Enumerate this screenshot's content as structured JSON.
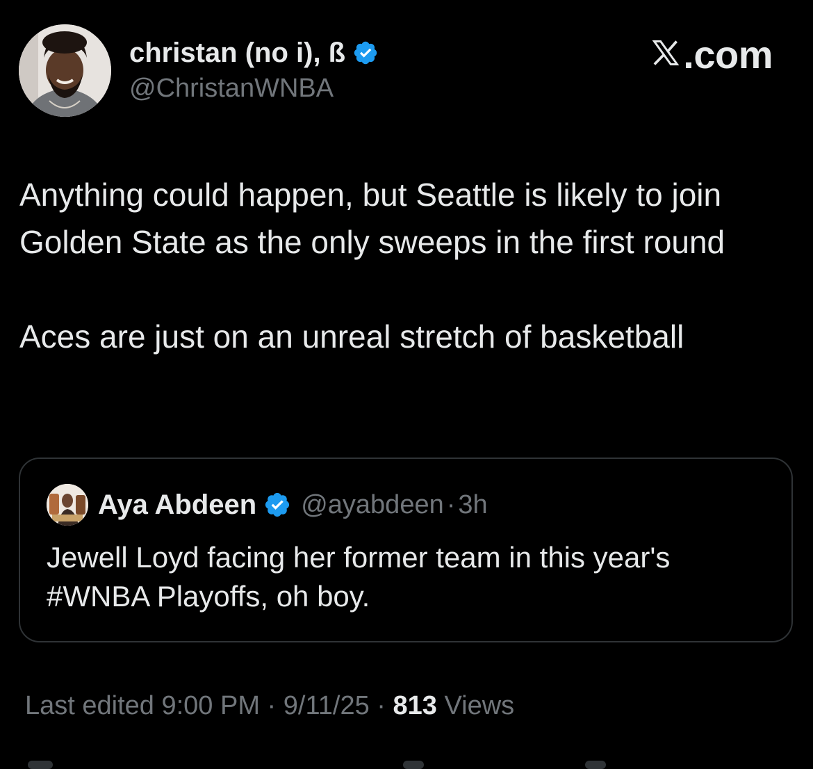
{
  "author": {
    "display_name": "christan (no i), ß",
    "handle": "@ChristanWNBA",
    "verified_icon": "verified-badge-icon"
  },
  "brand": {
    "site": ".com",
    "logo_icon": "x-logo-icon"
  },
  "tweet": {
    "paragraph_1": "Anything could happen, but Seattle is likely to join Golden State as the only sweeps in the first round",
    "paragraph_2": "Aces are just on an unreal stretch of basketball"
  },
  "quoted_tweet": {
    "display_name": "Aya Abdeen",
    "handle": "@ayabdeen",
    "separator": "·",
    "time": "3h",
    "text": "Jewell Loyd facing her former team in this year's #WNBA Playoffs, oh boy."
  },
  "meta": {
    "edited_label": "Last edited 9:00 PM · 9/11/25",
    "separator": " · ",
    "views_count": "813",
    "views_label": " Views"
  },
  "colors": {
    "background": "#000000",
    "text": "#e7e9ea",
    "muted": "#71767b",
    "verified": "#1d9bf0",
    "border": "#2f3336"
  }
}
